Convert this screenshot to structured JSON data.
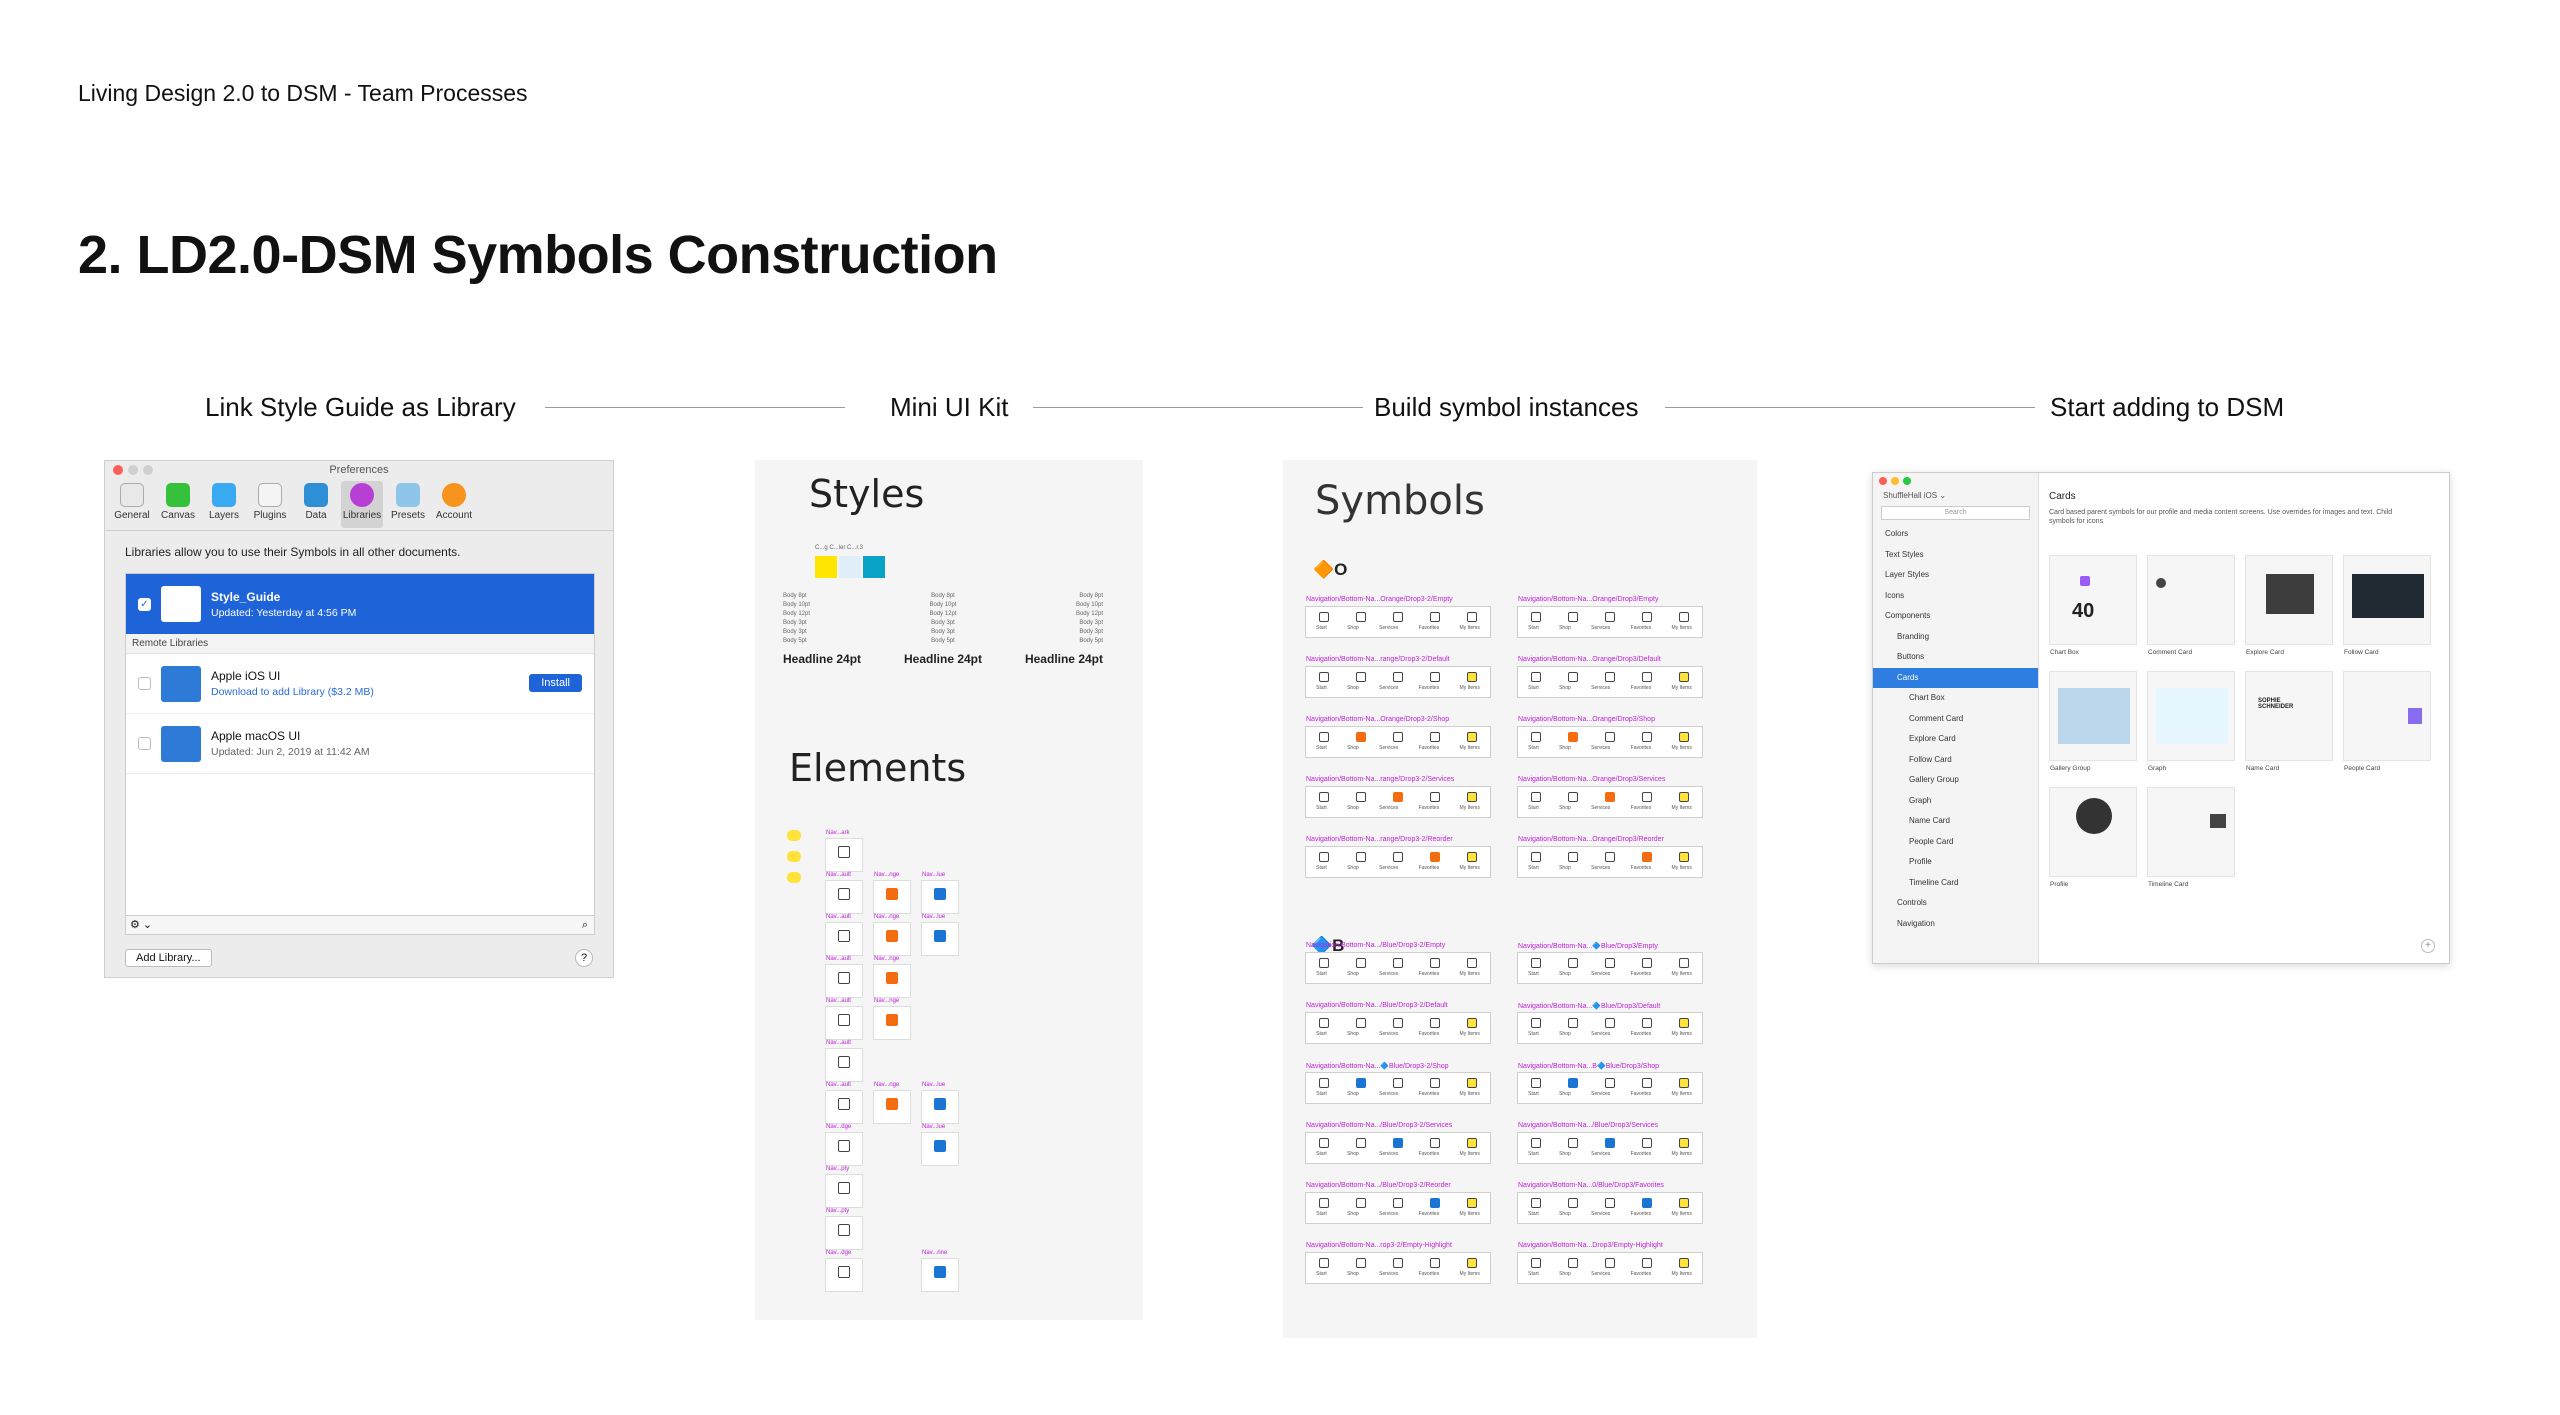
{
  "header": {
    "breadcrumb": "Living Design 2.0 to DSM - Team Processes",
    "title": "2. LD2.0-DSM Symbols Construction"
  },
  "steps": [
    "Link Style Guide as Library",
    "Mini UI Kit",
    "Build symbol instances",
    "Start adding to DSM"
  ],
  "preferences": {
    "window_title": "Preferences",
    "tabs": [
      "General",
      "Canvas",
      "Layers",
      "Plugins",
      "Data",
      "Libraries",
      "Presets",
      "Account"
    ],
    "active_tab": "Libraries",
    "description": "Libraries allow you to use their Symbols in all other documents.",
    "selected_library": {
      "name": "Style_Guide",
      "updated": "Updated: Yesterday at 4:56 PM"
    },
    "remote_label": "Remote Libraries",
    "remote": [
      {
        "name": "Apple iOS UI",
        "sub": "Download to add Library ($3.2 MB)",
        "action": "Install"
      },
      {
        "name": "Apple macOS UI",
        "sub": "Updated: Jun 2, 2019 at 11:42 AM"
      }
    ],
    "gear": "⚙︎ ⌄",
    "add_library": "Add Library...",
    "help": "?"
  },
  "kit": {
    "styles_title": "Styles",
    "swatch_label": "C...g  C...ler  C...r.3",
    "swatch_colors": [
      "#ffe600",
      "#dfeef8",
      "#0aa3c8"
    ],
    "type_lines": [
      "Body 8pt",
      "Body 10pt",
      "Body 12pt",
      "Body 3pt",
      "Body 3pt",
      "Body 5pt"
    ],
    "headline": "Headline 24pt",
    "elements_title": "Elements"
  },
  "symbols": {
    "title": "Symbols",
    "section_a": "🔶O",
    "section_b": "🔷B",
    "nav_labels": [
      "Start",
      "Shop",
      "Services",
      "Favorites",
      "My Items"
    ],
    "rows_a": [
      [
        "Navigation/Bottom-Na...Orange/Drop3-2/Empty",
        "Navigation/Bottom-Na...Orange/Drop3/Empty"
      ],
      [
        "Navigation/Bottom-Na...range/Drop3-2/Default",
        "Navigation/Bottom-Na...Orange/Drop3/Default"
      ],
      [
        "Navigation/Bottom-Na...Orange/Drop3-2/Shop",
        "Navigation/Bottom-Na...Orange/Drop3/Shop"
      ],
      [
        "Navigation/Bottom-Na...range/Drop3-2/Services",
        "Navigation/Bottom-Na...Orange/Drop3/Services"
      ],
      [
        "Navigation/Bottom-Na...range/Drop3-2/Reorder",
        "Navigation/Bottom-Na...Orange/Drop3/Reorder"
      ]
    ],
    "rows_b": [
      [
        "Navigation/Bottom-Na.../Blue/Drop3-2/Empty",
        "Navigation/Bottom-Na...🔷Blue/Drop3/Empty"
      ],
      [
        "Navigation/Bottom-Na.../Blue/Drop3-2/Default",
        "Navigation/Bottom-Na...🔷Blue/Drop3/Default"
      ],
      [
        "Navigation/Bottom-Na...🔷Blue/Drop3-2/Shop",
        "Navigation/Bottom-Na...B🔷Blue/Drop3/Shop"
      ],
      [
        "Navigation/Bottom-Na.../Blue/Drop3-2/Services",
        "Navigation/Bottom-Na.../Blue/Drop3/Services"
      ],
      [
        "Navigation/Bottom-Na.../Blue/Drop3-2/Reorder",
        "Navigation/Bottom-Na...0/Blue/Drop3/Favorites"
      ],
      [
        "Navigation/Bottom-Na...rop3-2/Empty-Highlight",
        "Navigation/Bottom-Na...Drop3/Empty-Highlight"
      ]
    ]
  },
  "dsm": {
    "project": "ShuffleHall iOS ⌄",
    "search_placeholder": "Search",
    "tree": [
      "Colors",
      "Text Styles",
      "Layer Styles",
      "Icons",
      "Components",
      "Branding",
      "Buttons",
      "Cards",
      "Chart Box",
      "Comment Card",
      "Explore Card",
      "Follow Card",
      "Gallery Group",
      "Graph",
      "Name Card",
      "People Card",
      "Profile",
      "Timeline Card",
      "Controls",
      "Navigation"
    ],
    "selected": "Cards",
    "section_title": "Cards",
    "section_desc": "Card based parent symbols for our profile and media content screens. Use overrides for images and text. Child symbols for icons",
    "cards": [
      "Chart Box",
      "Comment Card",
      "Explore Card",
      "Follow Card",
      "Gallery Group",
      "Graph",
      "Name Card",
      "People Card",
      "Profile",
      "Timeline Card"
    ],
    "chart_box_value": "40",
    "name_card_text": "SOPHIE SCHNEIDER",
    "plus": "+"
  }
}
